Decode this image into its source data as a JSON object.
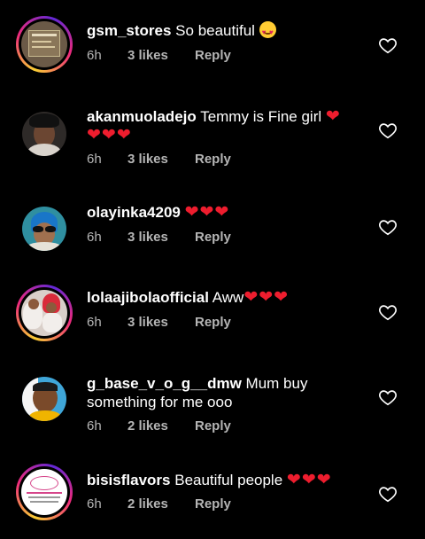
{
  "comments": [
    {
      "username": "gsm_stores",
      "text": "So beautiful",
      "emoji": "heart-eyes",
      "hearts": "",
      "time": "6h",
      "likes": "3 likes",
      "reply": "Reply",
      "avatar_ring": true
    },
    {
      "username": "akanmuoladejo",
      "text": "Temmy is Fine girl",
      "emoji": "",
      "hearts": "❤ ❤❤❤",
      "time": "6h",
      "likes": "3 likes",
      "reply": "Reply",
      "avatar_ring": false
    },
    {
      "username": "olayinka4209",
      "text": "",
      "emoji": "",
      "hearts": "❤❤❤",
      "time": "6h",
      "likes": "3 likes",
      "reply": "Reply",
      "avatar_ring": false
    },
    {
      "username": "lolaajibolaofficial",
      "text": "Aww",
      "emoji": "",
      "hearts": "❤❤❤",
      "time": "6h",
      "likes": "3 likes",
      "reply": "Reply",
      "avatar_ring": true
    },
    {
      "username": "g_base_v_o_g__dmw",
      "text": "Mum buy something for me ooo",
      "emoji": "",
      "hearts": "",
      "time": "6h",
      "likes": "2 likes",
      "reply": "Reply",
      "avatar_ring": false
    },
    {
      "username": "bisisflavors",
      "text": "Beautiful people",
      "emoji": "",
      "hearts": "❤❤❤",
      "time": "6h",
      "likes": "2 likes",
      "reply": "Reply",
      "avatar_ring": true
    }
  ],
  "colors": {
    "background": "#000000",
    "heart": "#ee1d2e",
    "meta": "#b5b5b5"
  },
  "icons": {
    "like": "heart-outline-icon"
  }
}
